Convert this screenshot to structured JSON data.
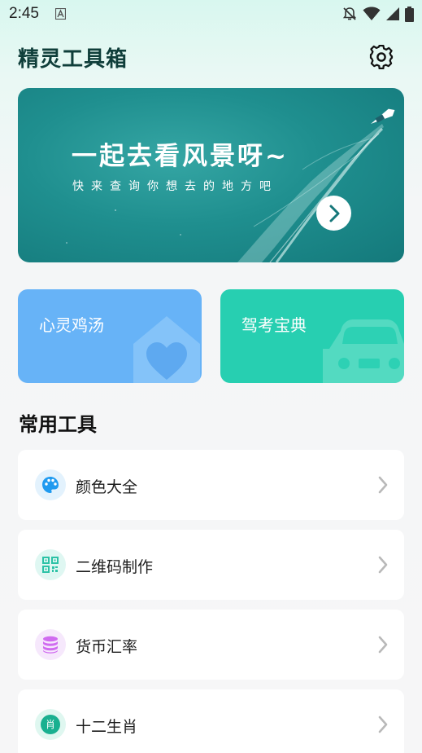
{
  "status_bar": {
    "time": "2:45",
    "icons": [
      "notification-a-icon",
      "bell-off-icon",
      "wifi-icon",
      "signal-icon",
      "battery-icon"
    ]
  },
  "header": {
    "title": "精灵工具箱",
    "settings_icon": "gear-icon"
  },
  "banner": {
    "title": "一起去看风景呀~",
    "subtitle": "快来查询你想去的地方吧",
    "arrow_icon": "chevron-right-icon"
  },
  "feature_cards": [
    {
      "label": "心灵鸡汤",
      "color": "#67b3f7",
      "icon": "home-heart-icon"
    },
    {
      "label": "驾考宝典",
      "color": "#27cfb1",
      "icon": "car-icon"
    }
  ],
  "section": {
    "title": "常用工具"
  },
  "tools": [
    {
      "label": "颜色大全",
      "icon": "palette-icon",
      "icon_color": "#1f9af0",
      "icon_bg": "#e3f2fd"
    },
    {
      "label": "二维码制作",
      "icon": "qr-code-icon",
      "icon_color": "#2cc2a6",
      "icon_bg": "#dff7f2"
    },
    {
      "label": "货币汇率",
      "icon": "coin-stack-icon",
      "icon_color": "#d06bf0",
      "icon_bg": "#f6e8fc"
    },
    {
      "label": "十二生肖",
      "icon": "zodiac-icon",
      "icon_color": "#19b090",
      "icon_bg": "#dff7f0",
      "icon_text": "肖"
    }
  ]
}
